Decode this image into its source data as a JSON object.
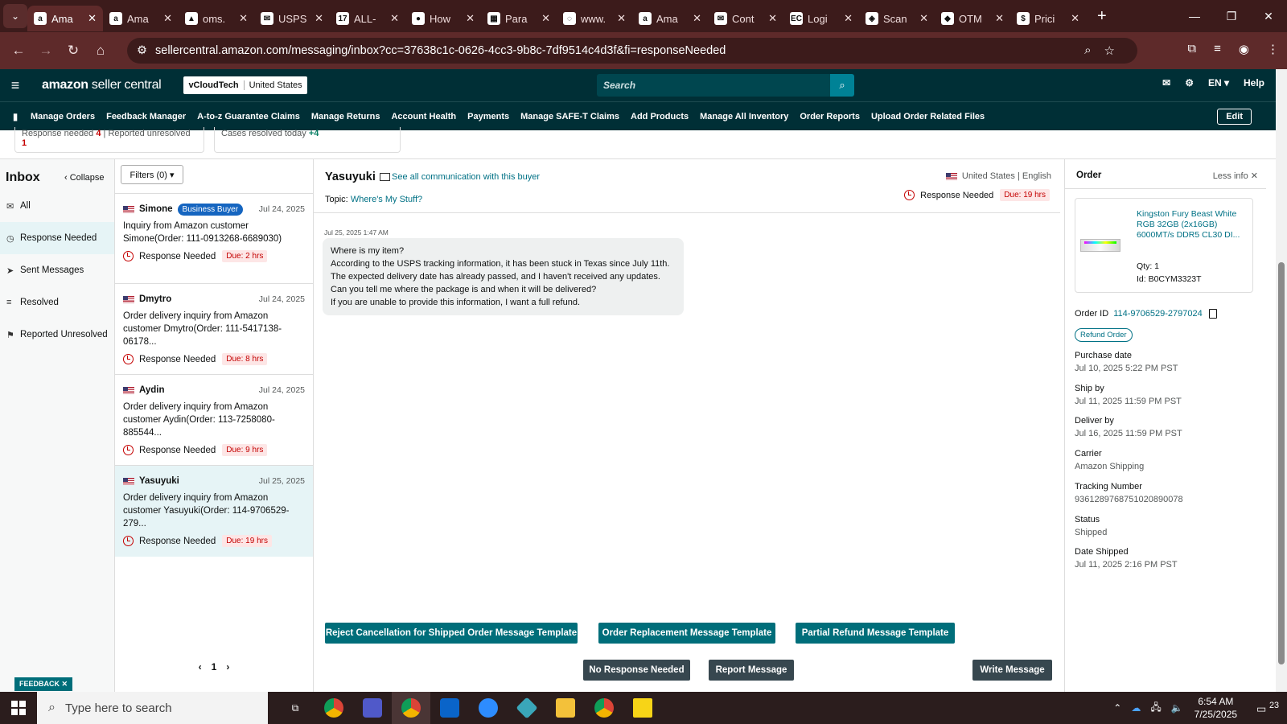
{
  "browser": {
    "tabs": [
      {
        "label": "Ama",
        "icon": "a",
        "active": true
      },
      {
        "label": "Ama",
        "icon": "a"
      },
      {
        "label": "oms.",
        "icon": "▲"
      },
      {
        "label": "USPS",
        "icon": "✉"
      },
      {
        "label": "ALL-",
        "icon": "17"
      },
      {
        "label": "How",
        "icon": "●"
      },
      {
        "label": "Para",
        "icon": "▦"
      },
      {
        "label": "www.",
        "icon": "◌"
      },
      {
        "label": "Ama",
        "icon": "a"
      },
      {
        "label": "Cont",
        "icon": "✉"
      },
      {
        "label": "Logi",
        "icon": "EC"
      },
      {
        "label": "Scan",
        "icon": "◈"
      },
      {
        "label": "OTM",
        "icon": "◆"
      },
      {
        "label": "Prici",
        "icon": "$"
      }
    ],
    "url": "sellercentral.amazon.com/messaging/inbox?cc=37638c1c-0626-4cc3-9b8c-7df9514c4d3f&fi=responseNeeded"
  },
  "header": {
    "logo_main": "amazon",
    "logo_sub": " seller central",
    "store": "vCloudTech",
    "marketplace": "United States",
    "search_placeholder": "Search",
    "lang": "EN ▾",
    "help": "Help"
  },
  "nav": {
    "items": [
      "Manage Orders",
      "Feedback Manager",
      "A-to-z Guarantee Claims",
      "Manage Returns",
      "Account Health",
      "Payments",
      "Manage SAFE-T Claims",
      "Add Products",
      "Manage All Inventory",
      "Order Reports",
      "Upload Order Related Files"
    ],
    "edit": "Edit"
  },
  "stats": {
    "response_needed_label": "Response needed",
    "response_needed_count": "4",
    "reported_unresolved_label": "Reported unresolved",
    "reported_unresolved_count": "1",
    "cases_resolved_label": "Cases resolved today",
    "cases_resolved_count": "+4"
  },
  "sidebar": {
    "title": "Inbox",
    "collapse": "Collapse",
    "items": [
      "All",
      "Response Needed",
      "Sent Messages",
      "Resolved",
      "Reported Unresolved"
    ]
  },
  "list": {
    "filters": "Filters (0) ▾",
    "page": "1",
    "conversations": [
      {
        "name": "Simone",
        "badge": "Business Buyer",
        "date": "Jul 24, 2025",
        "snippet": "Inquiry from Amazon customer Simone(Order: 111-0913268-6689030)",
        "status": "Response Needed",
        "due": "Due: 2 hrs"
      },
      {
        "name": "Dmytro",
        "date": "Jul 24, 2025",
        "snippet": "Order delivery inquiry from Amazon customer Dmytro(Order: 111-5417138-06178...",
        "status": "Response Needed",
        "due": "Due: 8 hrs"
      },
      {
        "name": "Aydin",
        "date": "Jul 24, 2025",
        "snippet": "Order delivery inquiry from Amazon customer Aydin(Order: 113-7258080-885544...",
        "status": "Response Needed",
        "due": "Due: 9 hrs"
      },
      {
        "name": "Yasuyuki",
        "date": "Jul 25, 2025",
        "snippet": "Order delivery inquiry from Amazon customer Yasuyuki(Order: 114-9706529-279...",
        "status": "Response Needed",
        "due": "Due: 19 hrs"
      }
    ]
  },
  "message": {
    "buyer": "Yasuyuki",
    "see_all": "See all communication with this buyer",
    "country": "United States",
    "language": "English",
    "topic_label": "Topic:",
    "topic": "Where's My Stuff?",
    "status": "Response Needed",
    "due": "Due: 19 hrs",
    "time": "Jul 25, 2025 1:47 AM",
    "lines": [
      "Where is my item?",
      "According to the USPS tracking information, it has been stuck in Texas since July 11th.",
      "The expected delivery date has already passed, and I haven't received any updates.",
      "Can you tell me where the package is and when it will be delivered?",
      "If you are unable to provide this information, I want a full refund."
    ],
    "templates": [
      "Reject Cancellation for Shipped Order Message Template",
      "Order Replacement Message Template",
      "Partial Refund Message Template"
    ],
    "write": "Write Message",
    "no_response": "No Response Needed",
    "report": "Report Message"
  },
  "order": {
    "title": "Order",
    "less_info": "Less info",
    "product_name": "Kingston Fury Beast White RGB 32GB (2x16GB) 6000MT/s DDR5 CL30 DI...",
    "qty": "Qty: 1",
    "id": "Id: B0CYM3323T",
    "order_id_label": "Order ID",
    "order_id": "114-9706529-2797024",
    "refund": "Refund Order",
    "fields": [
      {
        "label": "Purchase date",
        "value": "Jul 10, 2025 5:22 PM PST"
      },
      {
        "label": "Ship by",
        "value": "Jul 11, 2025 11:59 PM PST"
      },
      {
        "label": "Deliver by",
        "value": "Jul 16, 2025 11:59 PM PST"
      },
      {
        "label": "Carrier",
        "value": "Amazon Shipping"
      },
      {
        "label": "Tracking Number",
        "value": "9361289768751020890078"
      },
      {
        "label": "Status",
        "value": "Shipped"
      },
      {
        "label": "Date Shipped",
        "value": "Jul 11, 2025 2:16 PM PST"
      }
    ]
  },
  "feedback": "FEEDBACK ✕",
  "taskbar": {
    "search": "Type here to search",
    "time": "6:54 AM",
    "date": "7/25/2025",
    "notif": "23"
  }
}
